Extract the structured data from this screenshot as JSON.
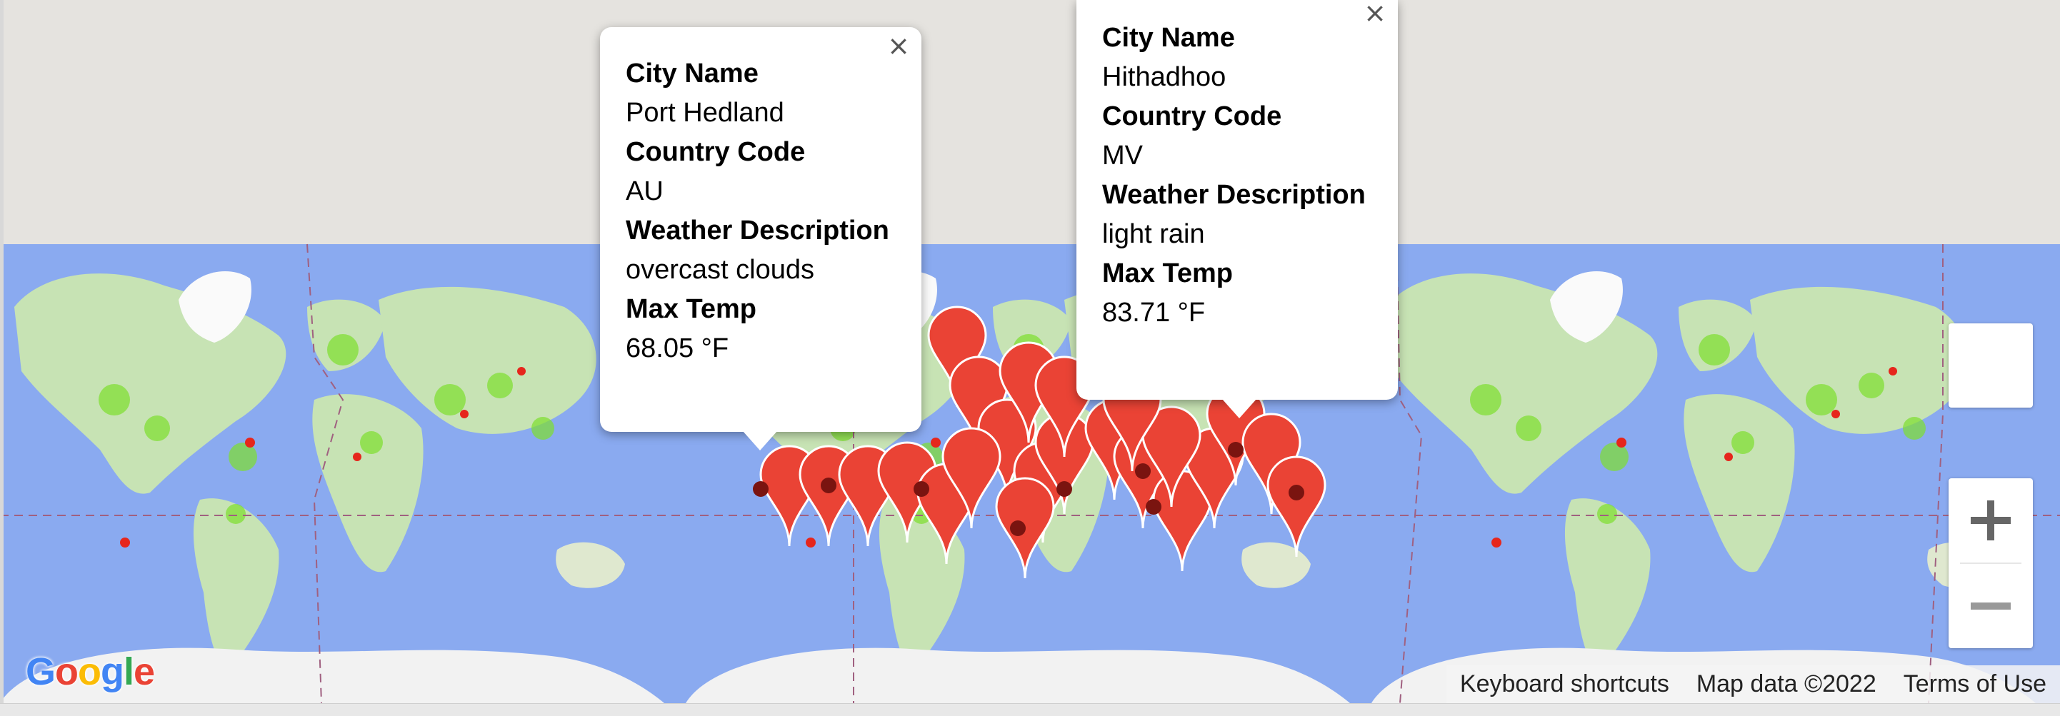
{
  "map": {
    "info_windows": [
      {
        "close_icon": "close-icon",
        "fields": [
          {
            "label": "City Name",
            "value": "Port Hedland"
          },
          {
            "label": "Country Code",
            "value": "AU"
          },
          {
            "label": "Weather Description",
            "value": "overcast clouds"
          },
          {
            "label": "Max Temp",
            "value": "68.05 °F"
          }
        ]
      },
      {
        "close_icon": "close-icon",
        "fields": [
          {
            "label": "City Name",
            "value": "Hithadhoo"
          },
          {
            "label": "Country Code",
            "value": "MV"
          },
          {
            "label": "Weather Description",
            "value": "light rain"
          },
          {
            "label": "Max Temp",
            "value": "83.71 °F"
          }
        ]
      }
    ],
    "controls": {
      "zoom_in_icon": "plus-icon",
      "zoom_out_icon": "minus-icon",
      "fullscreen_icon": "fullscreen-icon"
    },
    "attribution": {
      "keyboard": "Keyboard shortcuts",
      "map_data": "Map data ©2022",
      "terms": "Terms of Use"
    },
    "logo": "Google",
    "colors": {
      "ocean": "#8aaaf0",
      "marker": "#ea4335",
      "marker_dot": "#7a1410",
      "heat_green": "#7dde2c",
      "heat_red": "#e6261c"
    }
  }
}
